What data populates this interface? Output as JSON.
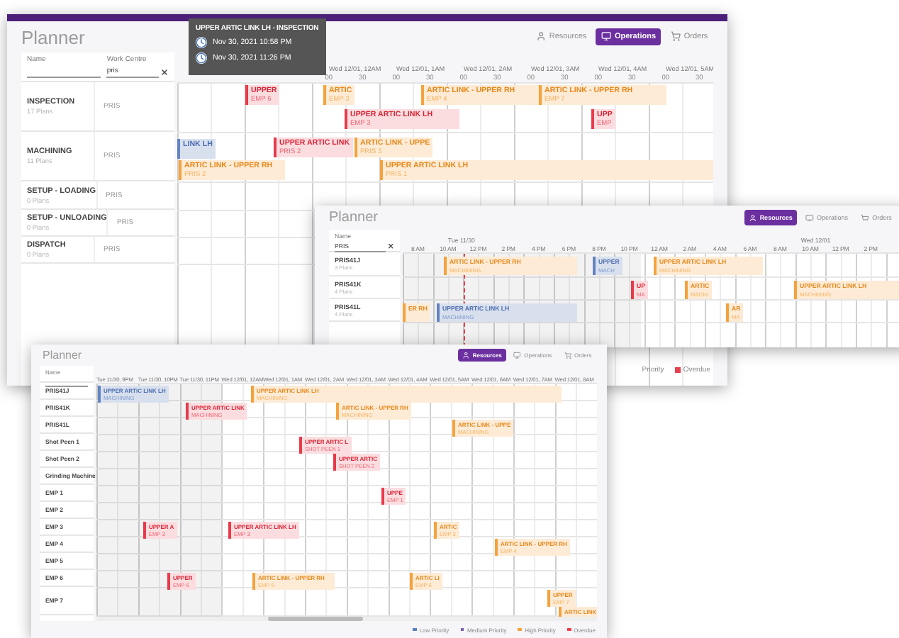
{
  "back_window": {
    "title": "Planner",
    "views": [
      {
        "label": "Resources",
        "selected": false
      },
      {
        "label": "Operations",
        "selected": true
      },
      {
        "label": "Orders",
        "selected": false
      }
    ],
    "filters": [
      {
        "label": "Name"
      },
      {
        "label": "Work Centre",
        "value": "pris"
      }
    ],
    "rows": [
      {
        "name": "INSPECTION",
        "plans": "17 Plans",
        "centre": "PRIS"
      },
      {
        "name": "MACHINING",
        "plans": "11 Plans",
        "centre": "PRIS"
      },
      {
        "name": "SETUP - LOADING",
        "plans": "0 Plans",
        "centre": "PRIS"
      },
      {
        "name": "SETUP - UNLOADING",
        "plans": "0 Plans",
        "centre": "PRIS"
      },
      {
        "name": "DISPATCH",
        "plans": "0 Plans",
        "centre": "PRIS"
      }
    ],
    "hours": [
      {
        "label": "Wed 12/01, 12AM",
        "ticks": [
          "00",
          "30"
        ]
      },
      {
        "label": "Wed 12/01, 1AM",
        "ticks": [
          "00",
          "30"
        ]
      },
      {
        "label": "Wed 12/01, 2AM",
        "ticks": [
          "00",
          "30"
        ]
      },
      {
        "label": "Wed 12/01, 3AM",
        "ticks": [
          "00",
          "30"
        ]
      },
      {
        "label": "Wed 12/01, 4AM",
        "ticks": [
          "00",
          "30"
        ]
      },
      {
        "label": "Wed 12/01, 5AM",
        "ticks": [
          "00",
          "30"
        ]
      }
    ],
    "tasks": [
      {
        "title": "UPPER",
        "detail": "EMP 6",
        "kind": "overdue"
      },
      {
        "title": "ARTIC",
        "detail": "EMP 3",
        "kind": "high"
      },
      {
        "title": "ARTIC LINK - UPPER RH",
        "detail": "EMP 4",
        "kind": "high"
      },
      {
        "title": "ARTIC LINK - UPPER RH",
        "detail": "EMP 7",
        "kind": "high"
      },
      {
        "title": "UPPER ARTIC LINK LH",
        "detail": "EMP 3",
        "kind": "overdue"
      },
      {
        "title": "UPP",
        "detail": "EMP",
        "kind": "overdue"
      },
      {
        "title": "LINK LH",
        "kind": "low"
      },
      {
        "title": "UPPER ARTIC LINK",
        "detail": "PRIS 2",
        "kind": "overdue"
      },
      {
        "title": "ARTIC LINK - UPPE",
        "detail": "PRIS 3",
        "kind": "high"
      },
      {
        "title": "ARTIC LINK - UPPER RH",
        "detail": "PRIS 2",
        "kind": "high"
      },
      {
        "title": "UPPER ARTIC LINK LH",
        "detail": "PRIS 1",
        "kind": "high"
      }
    ],
    "legend": [
      {
        "label": "Priority"
      },
      {
        "label": "Overdue",
        "color": "#e8404f"
      }
    ],
    "tooltip": {
      "title": "UPPER ARTIC LINK LH - INSPECTION",
      "start": "Nov 30, 2021 10:58 PM",
      "end": "Nov 30, 2021 11:26 PM"
    }
  },
  "middle_window": {
    "title": "Planner",
    "views": [
      {
        "label": "Resources",
        "selected": true
      },
      {
        "label": "Operations",
        "selected": false
      },
      {
        "label": "Orders",
        "selected": false
      }
    ],
    "filter": {
      "label": "Name",
      "value": "PRIS"
    },
    "rows": [
      {
        "name": "PRIS41J",
        "plans": "3 Plans"
      },
      {
        "name": "PRIS41K",
        "plans": "4 Plans"
      },
      {
        "name": "PRIS41L",
        "plans": "4 Plans"
      }
    ],
    "dates": [
      "Tue 11/30",
      "Wed 12/01"
    ],
    "hours": [
      "8 AM",
      "10 AM",
      "12 PM",
      "2 PM",
      "4 PM",
      "6 PM",
      "8 PM",
      "10 PM",
      "12 AM",
      "2 AM",
      "4 AM",
      "6 AM",
      "8 AM",
      "10 AM",
      "12 PM",
      "2 PM"
    ],
    "tasks": [
      {
        "title": "ARTIC LINK - UPPER RH",
        "detail": "MACHINING",
        "kind": "high"
      },
      {
        "title": "UPPER",
        "detail": "MACH",
        "kind": "low"
      },
      {
        "title": "UPPER ARTIC LINK LH",
        "detail": "MACHINING",
        "kind": "high"
      },
      {
        "title": "UP",
        "detail": "MA",
        "kind": "overdue"
      },
      {
        "title": "ARTIC",
        "detail": "MACHI",
        "kind": "high"
      },
      {
        "title": "UPPER ARTIC LINK LH",
        "detail": "MACHINING",
        "kind": "high"
      },
      {
        "title": "ER RH",
        "kind": "high"
      },
      {
        "title": "UPPER ARTIC LINK LH",
        "detail": "MACHINING",
        "kind": "low"
      },
      {
        "title": "AR",
        "detail": "MA",
        "kind": "high"
      }
    ]
  },
  "front_window": {
    "title": "Planner",
    "views": [
      {
        "label": "Resources",
        "selected": true
      },
      {
        "label": "Operations",
        "selected": false
      },
      {
        "label": "Orders",
        "selected": false
      }
    ],
    "filter": {
      "label": "Name"
    },
    "rows": [
      {
        "name": "PRIS41J"
      },
      {
        "name": "PRIS41K"
      },
      {
        "name": "PRIS41L"
      },
      {
        "name": "Shot Peen 1"
      },
      {
        "name": "Shot Peen 2"
      },
      {
        "name": "Grinding Machine"
      },
      {
        "name": "EMP 1"
      },
      {
        "name": "EMP 2"
      },
      {
        "name": "EMP 3"
      },
      {
        "name": "EMP 4"
      },
      {
        "name": "EMP 5"
      },
      {
        "name": "EMP 6"
      },
      {
        "name": "EMP 7"
      }
    ],
    "hours": [
      "Tue 11/30, 9PM",
      "Tue 11/30, 10PM",
      "Tue 11/30, 11PM",
      "Wed 12/01, 12AM",
      "Wed 12/01, 1AM",
      "Wed 12/01, 2AM",
      "Wed 12/01, 3AM",
      "Wed 12/01, 4AM",
      "Wed 12/01, 5AM",
      "Wed 12/01, 6AM",
      "Wed 12/01, 7AM",
      "Wed 12/01, 8AM"
    ],
    "tasks": [
      {
        "title": "UPPER ARTIC LINK LH",
        "detail": "MACHINING",
        "kind": "low"
      },
      {
        "title": "UPPER ARTIC LINK LH",
        "detail": "MACHINING",
        "kind": "high"
      },
      {
        "title": "UPPER ARTIC LINK",
        "detail": "MACHINING",
        "kind": "overdue"
      },
      {
        "title": "ARTIC LINK - UPPER RH",
        "detail": "MACHINING",
        "kind": "high"
      },
      {
        "title": "ARTIC LINK - UPPE",
        "detail": "MACHINING",
        "kind": "high"
      },
      {
        "title": "UPPER ARTIC L",
        "detail": "SHOT PEEN 1",
        "kind": "overdue"
      },
      {
        "title": "UPPER ARTIC",
        "detail": "SHOT PEEN 2",
        "kind": "overdue"
      },
      {
        "title": "UPPE",
        "detail": "EMP 1",
        "kind": "overdue"
      },
      {
        "title": "UPPER A",
        "detail": "EMP 3",
        "kind": "overdue"
      },
      {
        "title": "UPPER ARTIC LINK LH",
        "detail": "EMP 3",
        "kind": "overdue"
      },
      {
        "title": "ARTIC",
        "detail": "EMP 3",
        "kind": "high"
      },
      {
        "title": "ARTIC LINK - UPPER RH",
        "detail": "EMP 4",
        "kind": "high"
      },
      {
        "title": "UPPER",
        "detail": "EMP 6",
        "kind": "overdue"
      },
      {
        "title": "ARTIC LINK - UPPER RH",
        "detail": "EMP 6",
        "kind": "high"
      },
      {
        "title": "ARTIC LI",
        "detail": "EMP 6",
        "kind": "high"
      },
      {
        "title": "UPPER",
        "detail": "EMP 7",
        "kind": "high"
      },
      {
        "title": "ARTIC LINK",
        "kind": "high"
      }
    ],
    "legend": [
      {
        "label": "Low Priority",
        "color": "#5b7fc0"
      },
      {
        "label": "Medium Priority",
        "color": "#7b5bb5"
      },
      {
        "label": "High Priority",
        "color": "#f5a23c"
      },
      {
        "label": "Overdue",
        "color": "#e8404f"
      }
    ]
  }
}
